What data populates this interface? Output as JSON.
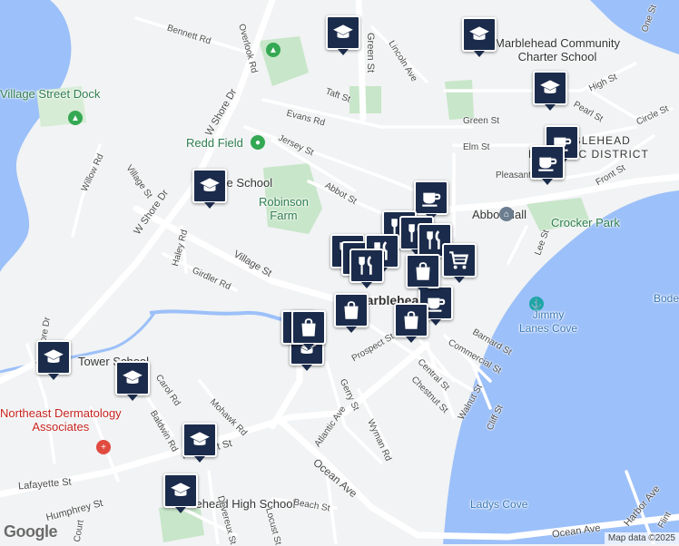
{
  "map": {
    "attribution": "Map data ©2025",
    "logo": "Google"
  },
  "places": {
    "village_dock": "Village Street Dock",
    "redd_field": "Redd Field",
    "village_school": "Village School",
    "robinson_farm": "Robinson\nFarm",
    "abbot_hall": "Abbot Hall",
    "crocker_park": "Crocker Park",
    "jimmy_lanes_cove": "Jimmy\nLanes Cove",
    "marblehead_charter": "Marblehead Community\nCharter School",
    "historic_district": "MARBLEHEAD\nHISTORIC DISTRICT",
    "tower_school": "Tower School",
    "dermatology": "Northeast Dermatology\nAssociates",
    "high_school": "Marblehead High School",
    "ladys_cove": "Ladys Cove",
    "marblehead": "Marblehead",
    "bode": "Bode"
  },
  "streets": {
    "bennett": "Bennett Rd",
    "overlook": "Overlook Rd",
    "green_st": "Green St",
    "lincoln": "Lincoln Ave",
    "w_shore_dr": "W Shore Dr",
    "taft": "Taft St",
    "evans": "Evans Rd",
    "jersey": "Jersey St",
    "green_st_e": "Green St",
    "pearl": "Pearl St",
    "high": "High St",
    "circle": "Circle St",
    "elm": "Elm St",
    "pleasant_e": "Pleasant St",
    "front": "Front St",
    "abbot": "Abbot St",
    "willow": "Willow Rd",
    "village_st_n": "Village St",
    "w_shore_dr_s": "W Shore Dr",
    "haley": "Haley Rd",
    "village_st": "Village St",
    "girdler": "Girdler Rd",
    "lee": "Lee St",
    "barnard": "Barnard St",
    "commercial": "Commercial St",
    "central": "Central St",
    "chestnut": "Chestnut St",
    "walnut": "Walnut St",
    "cliff": "Cliff St",
    "prospect": "Prospect St",
    "gerry": "Gerry St",
    "atlantic": "Atlantic Ave",
    "wyman": "Wyman Rd",
    "mohawk": "Mohawk Rd",
    "baldwin": "Baldwin Rd",
    "pleasant": "Pleasant St",
    "lafayette": "Lafayette St",
    "humphrey": "Humphrey St",
    "ocean_ave": "Ocean Ave",
    "beach": "Beach St",
    "devereux": "Devereux St",
    "locust": "Locust St",
    "ocean_ave_s": "Ocean Ave",
    "harbor": "Harbor Ave",
    "one": "One St",
    "w_shore_sw": "W Shore Dr",
    "carol": "Carol Rd",
    "flint": "Flint",
    "court": "Court",
    "prospect_n": "Pl"
  },
  "markers": [
    {
      "name": "school-marker",
      "icon": "school-icon"
    },
    {
      "name": "coffee-marker",
      "icon": "coffee-icon"
    },
    {
      "name": "restaurant-marker",
      "icon": "restaurant-icon"
    },
    {
      "name": "shopping-marker",
      "icon": "shopping-bag-icon"
    },
    {
      "name": "grocery-marker",
      "icon": "cart-icon"
    }
  ],
  "colors": {
    "water": "#9cc0f9",
    "park": "#c8e6c9",
    "road": "#ffffff",
    "marker": "#1b2b4b"
  }
}
